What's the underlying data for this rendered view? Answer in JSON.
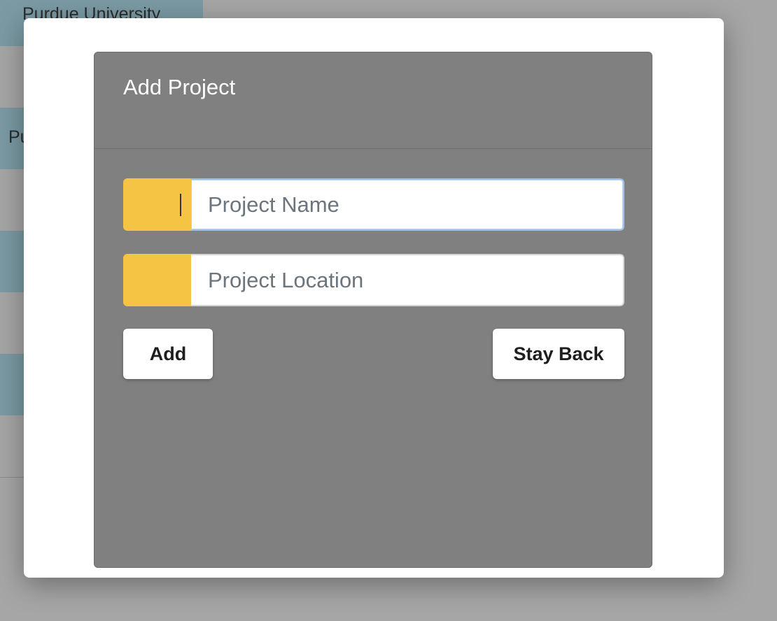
{
  "background": {
    "org_name": "Purdue University",
    "row_label_fragment": "Pu"
  },
  "modal": {
    "title": "Add Project",
    "project_name": {
      "value": "",
      "placeholder": "Project Name"
    },
    "project_location": {
      "value": "",
      "placeholder": "Project Location"
    },
    "add_label": "Add",
    "stay_back_label": "Stay Back"
  },
  "colors": {
    "card_bg": "#808080",
    "addon": "#f6c444",
    "overlay": "#a6a6a6",
    "list_stripe": "#7b9aa4"
  }
}
